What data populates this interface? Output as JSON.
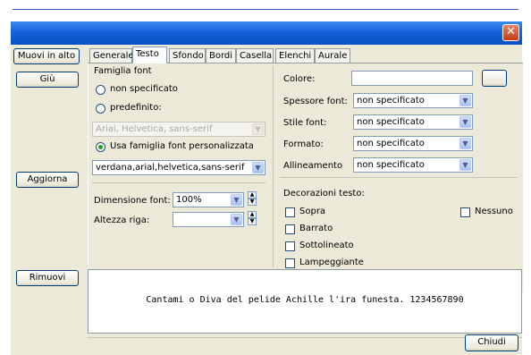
{
  "left_buttons": {
    "up": "Muovi in alto",
    "down": "Giù",
    "refresh": "Aggiorna",
    "remove": "Rimuovi"
  },
  "tabs": [
    {
      "label": "Generale"
    },
    {
      "label": "Testo"
    },
    {
      "label": "Sfondo"
    },
    {
      "label": "Bordi"
    },
    {
      "label": "Casella"
    },
    {
      "label": "Elenchi"
    },
    {
      "label": "Aurale"
    }
  ],
  "font": {
    "family_label": "Famiglia font",
    "opt_unspecified": "non specificato",
    "opt_predefined": "predefinito:",
    "predefined_value": "Arial, Helvetica, sans-serif",
    "opt_custom": "Usa famiglia font personalizzata",
    "custom_value": "verdana,arial,helvetica,sans-serif",
    "size_label": "Dimensione font:",
    "size_value": "100%",
    "line_height_label": "Altezza riga:",
    "line_height_value": ""
  },
  "right": {
    "color_label": "Colore:",
    "color_value": "",
    "weight_label": "Spessore font:",
    "weight_value": "non specificato",
    "style_label": "Stile font:",
    "style_value": "non specificato",
    "format_label": "Formato:",
    "format_value": "non specificato",
    "align_label": "Allineamento",
    "align_value": "non specificato",
    "decorations_label": "Decorazioni testo:",
    "dec_over": "Sopra",
    "dec_none": "Nessuno",
    "dec_strike": "Barrato",
    "dec_underline": "Sottolineato",
    "dec_blink": "Lampeggiante"
  },
  "preview_text": "Cantami o Diva del pelide Achille l'ira funesta. 1234567890",
  "close_label": "Chiudi",
  "colors": {
    "titlebar": "#0a4fc4",
    "dialog_bg": "#ece9d8",
    "check_green": "#21a121"
  }
}
